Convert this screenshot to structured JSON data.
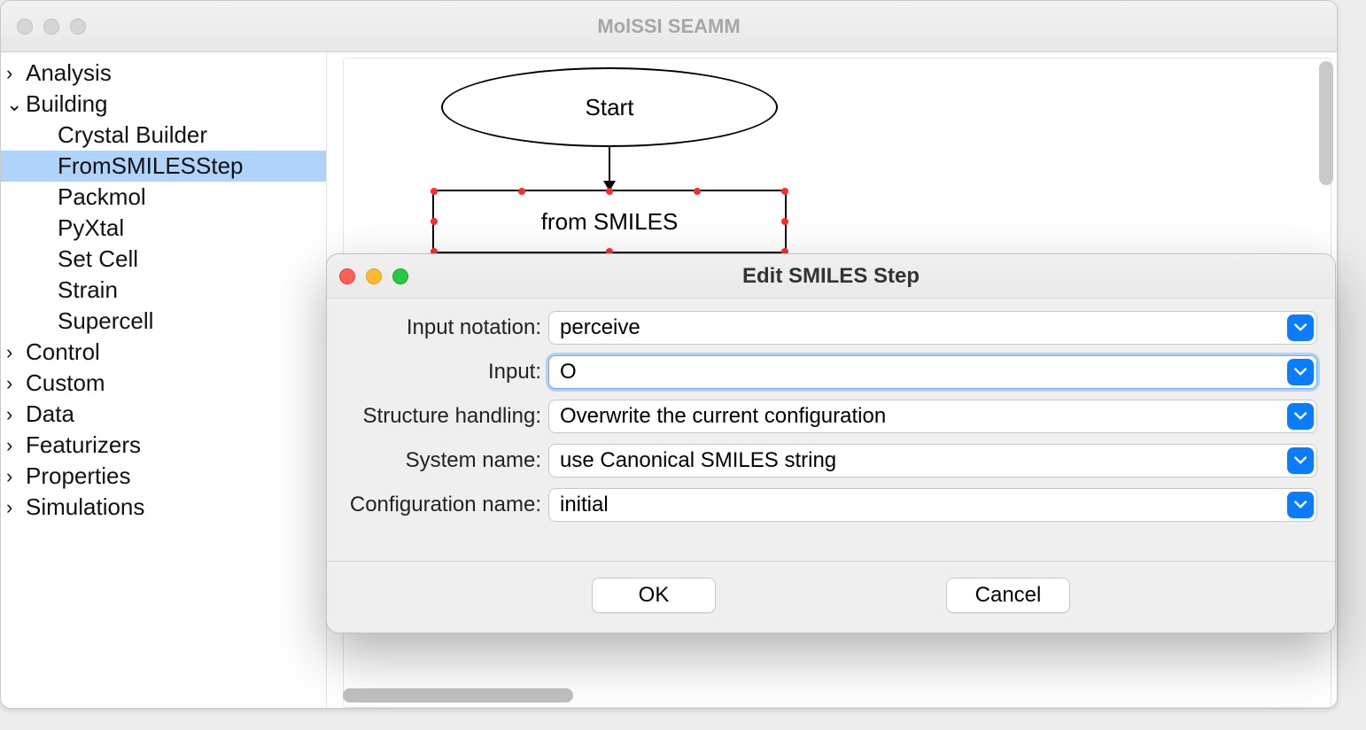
{
  "window": {
    "title": "MolSSI SEAMM"
  },
  "sidebar": [
    {
      "label": "Analysis",
      "expanded": false,
      "children": []
    },
    {
      "label": "Building",
      "expanded": true,
      "children": [
        {
          "label": "Crystal Builder",
          "selected": false
        },
        {
          "label": "FromSMILESStep",
          "selected": true
        },
        {
          "label": "Packmol",
          "selected": false
        },
        {
          "label": "PyXtal",
          "selected": false
        },
        {
          "label": "Set Cell",
          "selected": false
        },
        {
          "label": "Strain",
          "selected": false
        },
        {
          "label": "Supercell",
          "selected": false
        }
      ]
    },
    {
      "label": "Control",
      "expanded": false,
      "children": []
    },
    {
      "label": "Custom",
      "expanded": false,
      "children": []
    },
    {
      "label": "Data",
      "expanded": false,
      "children": []
    },
    {
      "label": "Featurizers",
      "expanded": false,
      "children": []
    },
    {
      "label": "Properties",
      "expanded": false,
      "children": []
    },
    {
      "label": "Simulations",
      "expanded": false,
      "children": []
    }
  ],
  "canvas": {
    "start_label": "Start",
    "step_label": "from SMILES"
  },
  "dialog": {
    "title": "Edit SMILES Step",
    "fields": {
      "input_notation": {
        "label": "Input notation:",
        "value": "perceive"
      },
      "input": {
        "label": "Input:",
        "value": "O",
        "focused": true
      },
      "structure": {
        "label": "Structure handling:",
        "value": "Overwrite the current configuration"
      },
      "system_name": {
        "label": "System name:",
        "value": "use Canonical SMILES string"
      },
      "config_name": {
        "label": "Configuration name:",
        "value": "initial"
      }
    },
    "buttons": {
      "ok": "OK",
      "cancel": "Cancel"
    }
  }
}
